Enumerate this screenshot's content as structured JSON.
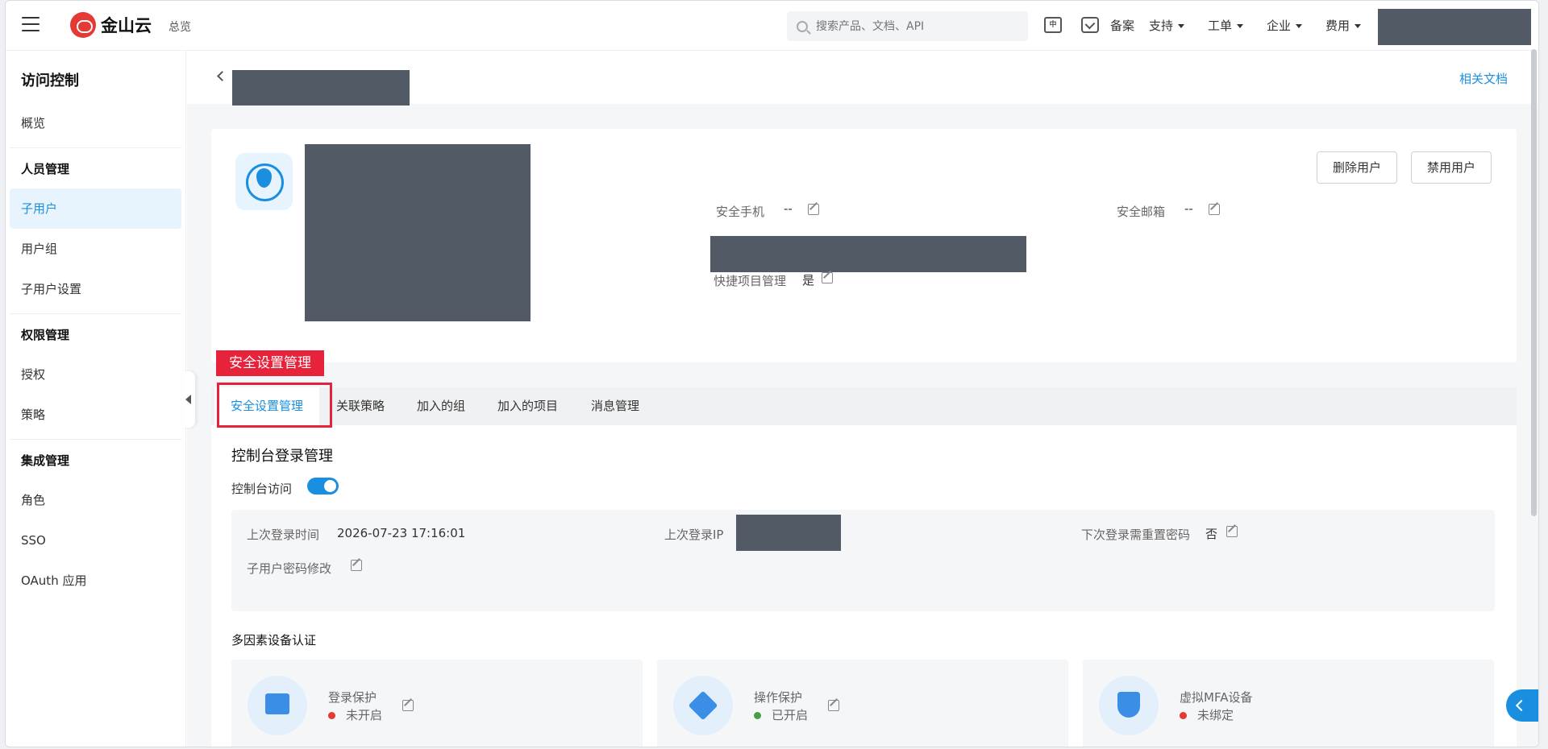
{
  "header": {
    "logo_text": "金山云",
    "overview": "总览",
    "search_placeholder": "搜索产品、文档、API",
    "lang_icon": "translate-icon",
    "menu": {
      "filing": "备案",
      "support": "支持",
      "ticket": "工单",
      "enterprise": "企业",
      "billing": "费用"
    }
  },
  "sidebar": {
    "title": "访问控制",
    "overview": "概览",
    "groups": {
      "people": "人员管理",
      "permissions": "权限管理",
      "integration": "集成管理"
    },
    "items": {
      "sub_user": "子用户",
      "user_group": "用户组",
      "sub_user_settings": "子用户设置",
      "authorization": "授权",
      "policy": "策略",
      "role": "角色",
      "sso": "SSO",
      "oauth": "OAuth 应用"
    }
  },
  "page": {
    "docs_link": "相关文档",
    "delete_user": "删除用户",
    "disable_user": "禁用用户",
    "security_phone_label": "安全手机",
    "security_phone_value": "--",
    "security_email_label": "安全邮箱",
    "security_email_value": "--",
    "quick_project_label": "快捷项目管理",
    "quick_project_value": "是"
  },
  "tabs": {
    "callout": "安全设置管理",
    "security": "安全设置管理",
    "policies": "关联策略",
    "groups": "加入的组",
    "projects": "加入的项目",
    "messages": "消息管理"
  },
  "console": {
    "title": "控制台登录管理",
    "access_label": "控制台访问",
    "access_enabled": true,
    "last_login_time_label": "上次登录时间",
    "last_login_time": "2026-07-23 17:16:01",
    "last_login_ip_label": "上次登录IP",
    "reset_password_label": "下次登录需重置密码",
    "reset_password_value": "否",
    "password_change_label": "子用户密码修改"
  },
  "mfa": {
    "title": "多因素设备认证",
    "cards": [
      {
        "name": "登录保护",
        "status": "未开启",
        "status_color": "#e53935"
      },
      {
        "name": "操作保护",
        "status": "已开启",
        "status_color": "#43a047"
      },
      {
        "name": "虚拟MFA设备",
        "status": "未绑定",
        "status_color": "#e53935"
      }
    ]
  },
  "colors": {
    "accent": "#1a8fe0",
    "highlight": "#e7223b",
    "redaction": "#525a66"
  }
}
